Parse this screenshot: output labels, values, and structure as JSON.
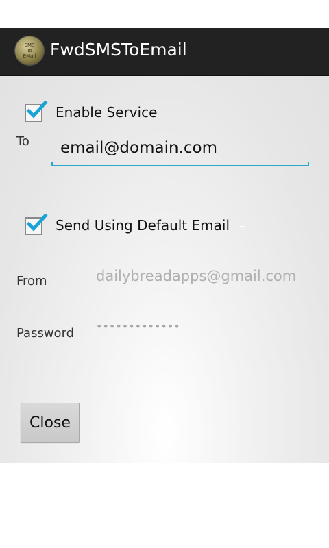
{
  "app": {
    "title": "FwdSMSToEmail",
    "icon_name": "app-logo-icon",
    "icon_text": [
      "SMS",
      "To",
      "EMail"
    ]
  },
  "form": {
    "enable_service": {
      "label": "Enable Service",
      "checked": true
    },
    "to": {
      "label": "To",
      "value": "email@domain.com"
    },
    "send_default": {
      "label": "Send Using Default Email",
      "checked": true
    },
    "from": {
      "label": "From",
      "value": "dailybreadapps@gmail.com",
      "enabled": false
    },
    "password": {
      "label": "Password",
      "value": "•••••••••••••",
      "enabled": false
    }
  },
  "buttons": {
    "close_label": "Close"
  },
  "colors": {
    "actionbar": "#222222",
    "accent": "#2ea6c9",
    "disabled_text": "#b0b0b0"
  }
}
